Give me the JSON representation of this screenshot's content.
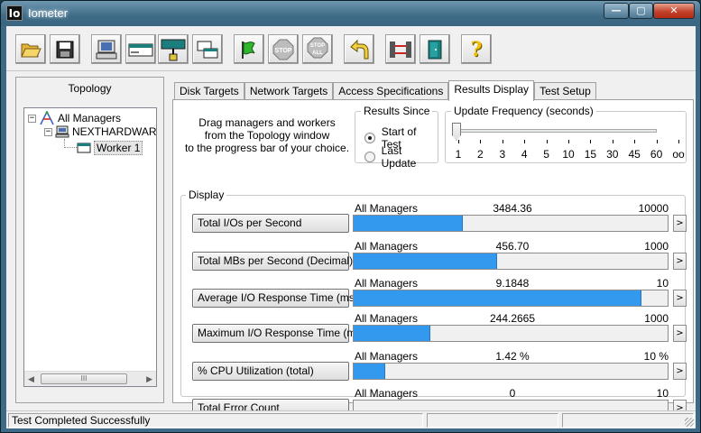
{
  "window": {
    "title": "Iometer",
    "app_icon_text": "Io",
    "min_glyph": "—",
    "max_glyph": "▢",
    "close_glyph": "✕"
  },
  "toolbar": {
    "buttons": [
      {
        "name": "open-config-button",
        "icon": "open-folder-icon"
      },
      {
        "name": "save-config-button",
        "icon": "floppy-disk-icon"
      },
      {
        "name": "new-manager-button",
        "icon": "computer-icon"
      },
      {
        "name": "new-worker-button",
        "icon": "disk-worker-icon"
      },
      {
        "name": "new-network-worker-button",
        "icon": "network-icon"
      },
      {
        "name": "duplicate-worker-button",
        "icon": "duplicate-icon"
      },
      {
        "name": "start-tests-button",
        "icon": "green-flag-icon"
      },
      {
        "name": "stop-button",
        "icon": "stop-sign-icon"
      },
      {
        "name": "stop-all-button",
        "icon": "stop-all-icon"
      },
      {
        "name": "reset-workers-button",
        "icon": "undo-arrow-icon"
      },
      {
        "name": "disconnect-button",
        "icon": "disconnect-icon"
      },
      {
        "name": "exit-button",
        "icon": "exit-door-icon"
      },
      {
        "name": "help-button",
        "icon": "help-question-icon"
      }
    ],
    "stop_text": "STOP",
    "stop_all_text": "STOP",
    "stop_all_sub": "ALL",
    "help_glyph": "?"
  },
  "topology": {
    "title": "Topology",
    "root_label": "All Managers",
    "manager_label": "NEXTHARDWAR",
    "worker_label": "Worker 1",
    "expander_open": "−",
    "scroll_left": "◀",
    "scroll_right": "▶",
    "scroll_grip": "III"
  },
  "tabs": [
    {
      "label": "Disk Targets"
    },
    {
      "label": "Network Targets"
    },
    {
      "label": "Access Specifications"
    },
    {
      "label": "Results Display"
    },
    {
      "label": "Test Setup"
    }
  ],
  "results": {
    "intro_lines": [
      "Drag managers and workers",
      "from the Topology window",
      "to the progress bar of your choice."
    ],
    "since_title": "Results Since",
    "since_options": [
      "Start of Test",
      "Last Update"
    ],
    "since_selected": 0,
    "update_title": "Update Frequency (seconds)",
    "update_ticks": [
      "1",
      "2",
      "3",
      "4",
      "5",
      "10",
      "15",
      "30",
      "45",
      "60",
      "oo"
    ],
    "update_selected": 0,
    "display_title": "Display",
    "arrow_glyph": ">",
    "metrics": [
      {
        "button": "Total I/Os per Second",
        "source": "All Managers",
        "value": "3484.36",
        "max": "10000",
        "fraction": 0.348
      },
      {
        "button": "Total MBs per Second (Decimal)",
        "source": "All Managers",
        "value": "456.70",
        "max": "1000",
        "fraction": 0.457
      },
      {
        "button": "Average I/O Response Time (ms)",
        "source": "All Managers",
        "value": "9.1848",
        "max": "10",
        "fraction": 0.918
      },
      {
        "button": "Maximum I/O Response Time (ms)",
        "source": "All Managers",
        "value": "244.2665",
        "max": "1000",
        "fraction": 0.244
      },
      {
        "button": "% CPU Utilization (total)",
        "source": "All Managers",
        "value": "1.42 %",
        "max": "10 %",
        "fraction": 0.102
      },
      {
        "button": "Total Error Count",
        "source": "All Managers",
        "value": "0",
        "max": "10",
        "fraction": 0
      }
    ]
  },
  "status": {
    "message": "Test Completed Successfully"
  },
  "colors": {
    "bar_fill": "#3399ee",
    "title_bar": "#3e6b87",
    "close_button": "#c4422c"
  }
}
